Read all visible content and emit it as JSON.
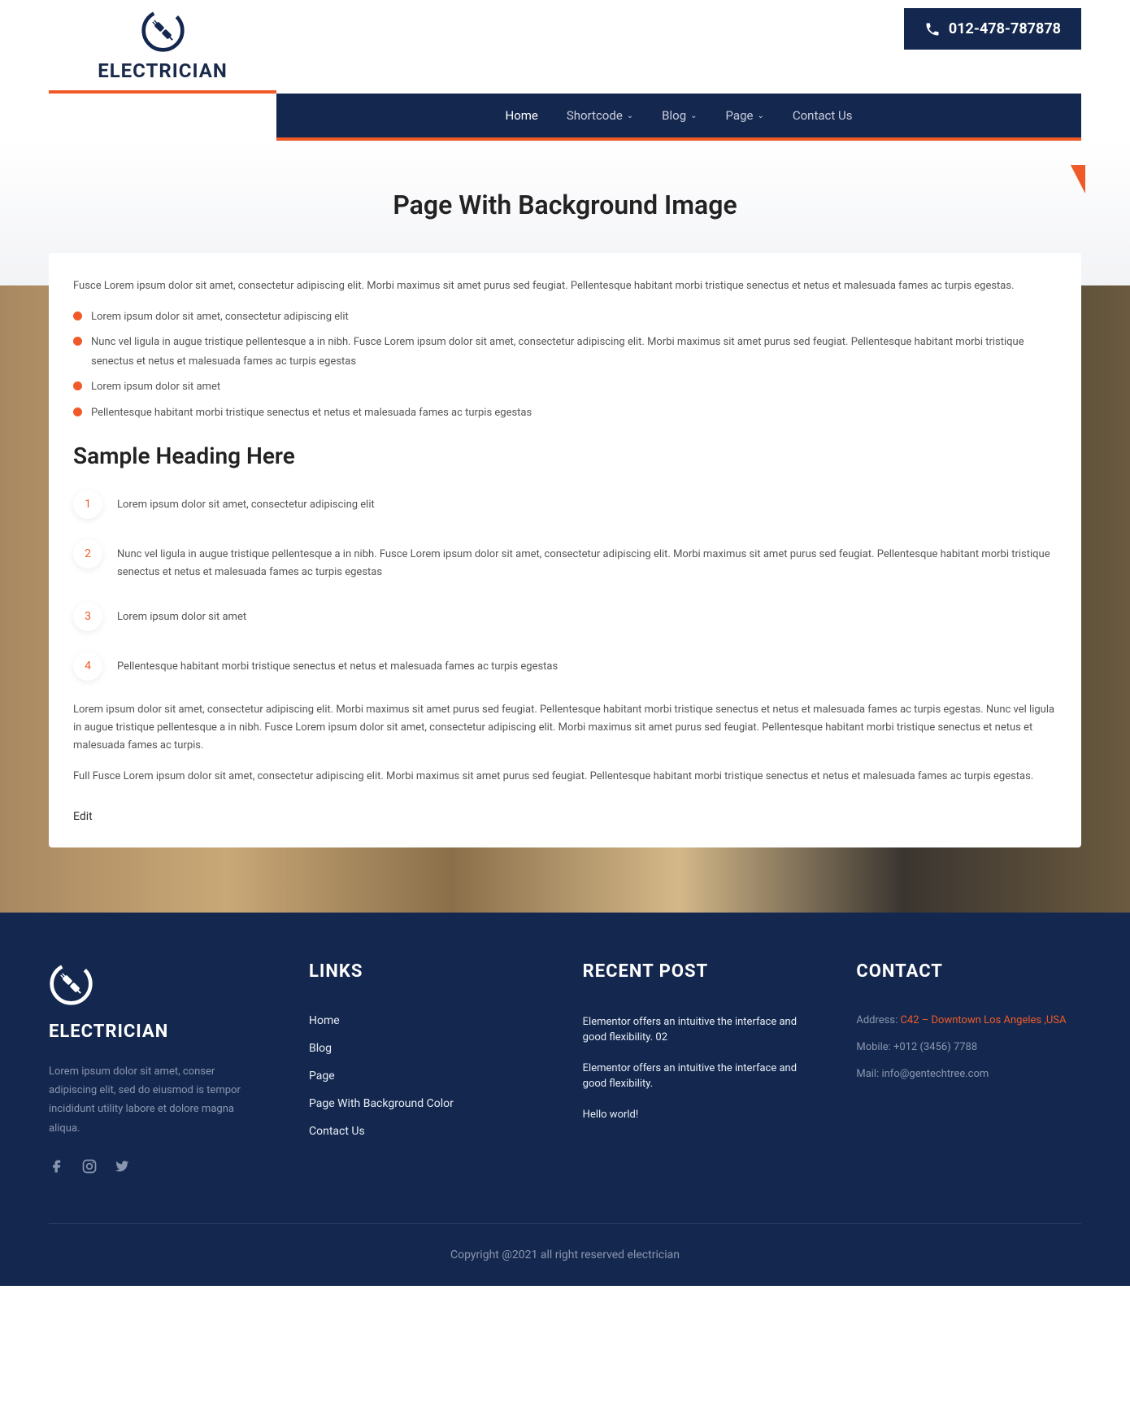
{
  "brand": "ELECTRICIAN",
  "phone": "012-478-787878",
  "nav": {
    "items": [
      {
        "label": "Home",
        "dropdown": false
      },
      {
        "label": "Shortcode",
        "dropdown": true
      },
      {
        "label": "Blog",
        "dropdown": true
      },
      {
        "label": "Page",
        "dropdown": true
      },
      {
        "label": "Contact Us",
        "dropdown": false
      }
    ]
  },
  "page_title": "Page With Background Image",
  "content": {
    "intro": "Fusce Lorem ipsum dolor sit amet, consectetur adipiscing elit. Morbi maximus sit amet purus sed feugiat. Pellentesque habitant morbi tristique senectus et netus et malesuada fames ac turpis egestas.",
    "bullets": [
      "Lorem ipsum dolor sit amet, consectetur adipiscing elit",
      "Nunc vel ligula in augue tristique pellentesque a in nibh. Fusce Lorem ipsum dolor sit amet, consectetur adipiscing elit. Morbi maximus sit amet purus sed feugiat. Pellentesque habitant morbi tristique senectus et netus et malesuada fames ac turpis egestas",
      "Lorem ipsum dolor sit amet",
      "Pellentesque habitant morbi tristique senectus et netus et malesuada fames ac turpis egestas"
    ],
    "heading": "Sample Heading Here",
    "numbered": [
      "Lorem ipsum dolor sit amet, consectetur adipiscing elit",
      "Nunc vel ligula in augue tristique pellentesque a in nibh. Fusce Lorem ipsum dolor sit amet, consectetur adipiscing elit. Morbi maximus sit amet purus sed feugiat. Pellentesque habitant morbi tristique senectus et netus et malesuada fames ac turpis egestas",
      "Lorem ipsum dolor sit amet",
      "Pellentesque habitant morbi tristique senectus et netus et malesuada fames ac turpis egestas"
    ],
    "para2": "Lorem ipsum dolor sit amet, consectetur adipiscing elit. Morbi maximus sit amet purus sed feugiat. Pellentesque habitant morbi tristique senectus et netus et malesuada fames ac turpis egestas. Nunc vel ligula in augue tristique pellentesque a in nibh. Fusce Lorem ipsum dolor sit amet, consectetur adipiscing elit. Morbi maximus sit amet purus sed feugiat. Pellentesque habitant morbi tristique senectus et netus et malesuada fames ac turpis.",
    "para3": "Full Fusce Lorem ipsum dolor sit amet, consectetur adipiscing elit. Morbi maximus sit amet purus sed feugiat. Pellentesque habitant morbi tristique senectus et netus et malesuada fames ac turpis egestas.",
    "edit": "Edit"
  },
  "footer": {
    "desc": "Lorem ipsum dolor sit amet, conser adipiscing elit, sed do eiusmod is tempor incididunt utility labore et dolore magna aliqua.",
    "links_heading": "LINKS",
    "links": [
      "Home",
      "Blog",
      "Page",
      "Page With Background Color",
      "Contact Us"
    ],
    "recent_heading": "RECENT POST",
    "recent": [
      "Elementor offers an intuitive the interface and good flexibility. 02",
      "Elementor offers an intuitive the interface and good flexibility.",
      "Hello world!"
    ],
    "contact_heading": "CONTACT",
    "address_label": "Address: ",
    "address_value": "C42 – Downtown Los Angeles ,USA",
    "mobile": "Mobile: +012 (3456) 7788",
    "mail": "Mail: info@gentechtree.com",
    "copyright": "Copyright @2021 all right reserved electrician"
  }
}
